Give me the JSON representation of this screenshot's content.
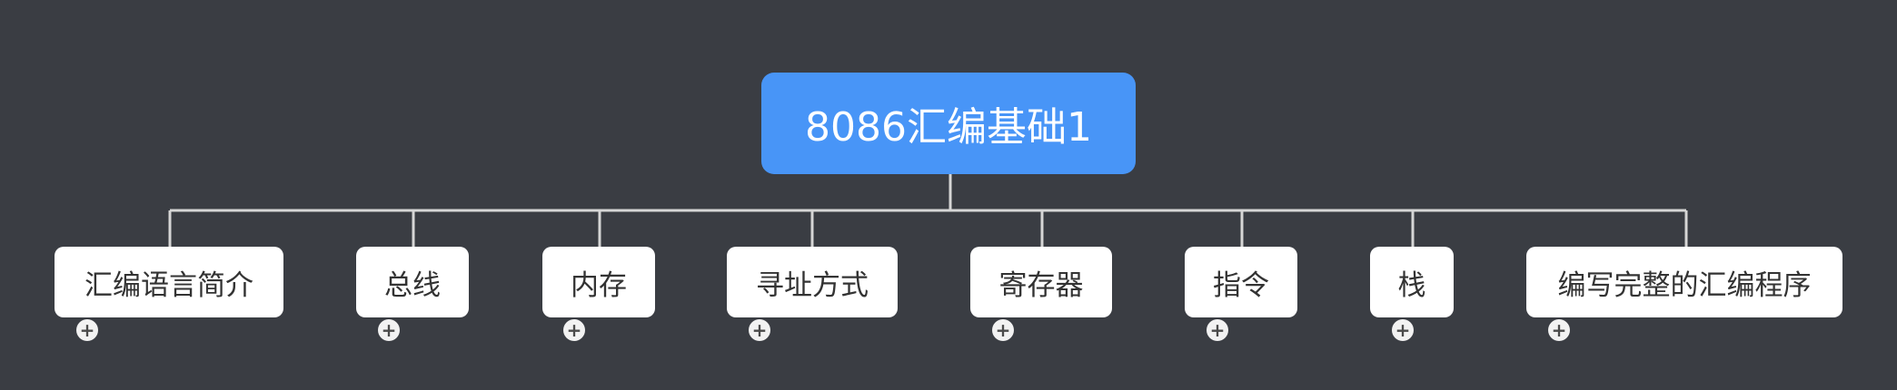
{
  "mindmap": {
    "root": {
      "label": "8086汇编基础1"
    },
    "topics": [
      {
        "label": "汇编语言简介"
      },
      {
        "label": "总线"
      },
      {
        "label": "内存"
      },
      {
        "label": "寻址方式"
      },
      {
        "label": "寄存器"
      },
      {
        "label": "指令"
      },
      {
        "label": "栈"
      },
      {
        "label": "编写完整的汇编程序"
      }
    ],
    "expand_glyph": "+",
    "colors": {
      "background": "#3a3d43",
      "root_fill": "#4895f7",
      "topic_fill": "#ffffff",
      "connector": "#d6d6d6"
    }
  }
}
